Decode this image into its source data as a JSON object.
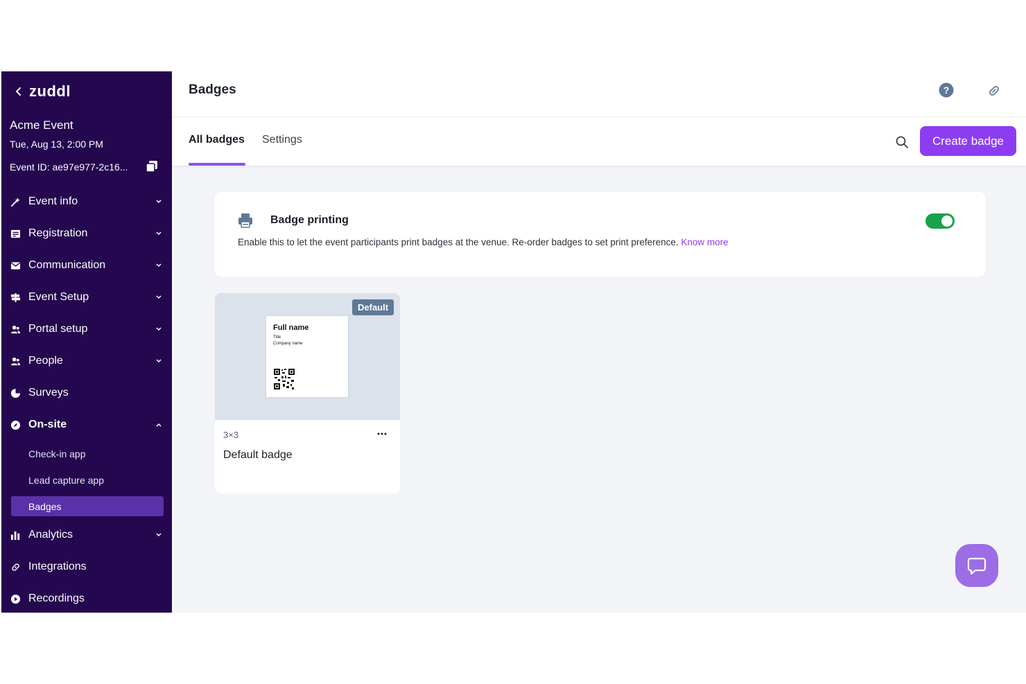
{
  "sidebar": {
    "logo": "zuddl",
    "event_name": "Acme Event",
    "event_date": "Tue, Aug 13, 2:00 PM",
    "event_id": "Event ID: ae97e977-2c16...",
    "items": [
      {
        "label": "Event info"
      },
      {
        "label": "Registration"
      },
      {
        "label": "Communication"
      },
      {
        "label": "Event Setup"
      },
      {
        "label": "Portal setup"
      },
      {
        "label": "People"
      },
      {
        "label": "Surveys"
      },
      {
        "label": "On-site"
      },
      {
        "label": "Analytics"
      },
      {
        "label": "Integrations"
      },
      {
        "label": "Recordings"
      }
    ],
    "onsite_sub": [
      {
        "label": "Check-in app"
      },
      {
        "label": "Lead capture app"
      },
      {
        "label": "Badges"
      }
    ]
  },
  "header": {
    "title": "Badges",
    "tabs": [
      {
        "label": "All badges"
      },
      {
        "label": "Settings"
      }
    ],
    "create_label": "Create badge"
  },
  "printing": {
    "title": "Badge printing",
    "description": "Enable this to let the event participants print badges at the venue. Re-order badges to set print preference.",
    "link": "Know more",
    "enabled": true
  },
  "badge": {
    "tag": "Default",
    "preview_name": "Full name",
    "preview_title": "Title",
    "preview_company": "Company name",
    "size": "3×3",
    "name": "Default badge"
  },
  "colors": {
    "sidebar": "#24074f",
    "accent": "#8d3df0",
    "toggle_on": "#16a34a",
    "tag": "#5f7896"
  }
}
